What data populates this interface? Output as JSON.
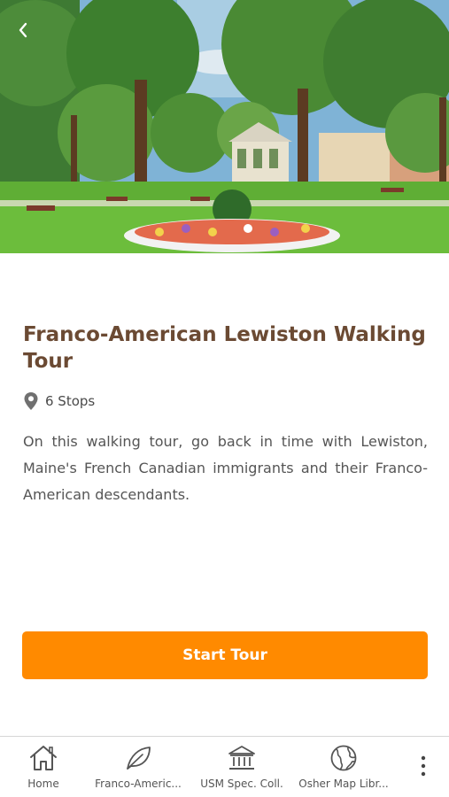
{
  "hero": {
    "image_subject": "vintage postcard of a city park with bandstand, trees and flower bed"
  },
  "tour": {
    "title": "Franco-American Lewiston Walking Tour",
    "stops_label": "6 Stops",
    "description": "On this walking tour, go back in time with Lewiston, Maine's French Canadian immigrants and their Franco-American descendants."
  },
  "actions": {
    "start_label": "Start Tour"
  },
  "tabbar": {
    "tabs": [
      {
        "label": "Home",
        "icon": "home-icon"
      },
      {
        "label": "Franco-Americ...",
        "icon": "leaf-icon"
      },
      {
        "label": "USM Spec. Coll.",
        "icon": "bank-icon"
      },
      {
        "label": "Osher Map Libr...",
        "icon": "globe-icon"
      }
    ],
    "more_icon": "more-vertical-icon"
  },
  "colors": {
    "accent": "#ff8a00",
    "title": "#6b4a33",
    "text": "#555555"
  }
}
